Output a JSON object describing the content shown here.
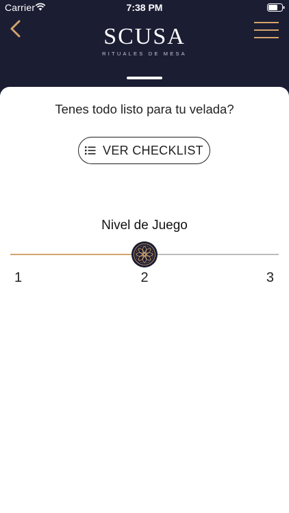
{
  "status_bar": {
    "carrier": "Carrier",
    "time": "7:38 PM"
  },
  "header": {
    "brand": "SCUSA",
    "tagline": "RITUALES DE MESA"
  },
  "prompt": {
    "question": "Tenes todo listo para tu velada?"
  },
  "checklist": {
    "button_label": "VER CHECKLIST"
  },
  "level": {
    "title": "Nivel de Juego",
    "ticks": [
      "1",
      "2",
      "3"
    ],
    "min": 1,
    "max": 3,
    "value": 2
  },
  "colors": {
    "header_bg": "#1b1d33",
    "accent": "#d2a46c",
    "track_inactive": "#bdbdbd"
  },
  "icons": [
    "wifi-icon",
    "battery-icon",
    "back-chevron-icon",
    "hamburger-menu-icon",
    "list-icon",
    "mandala-thumb-icon"
  ]
}
